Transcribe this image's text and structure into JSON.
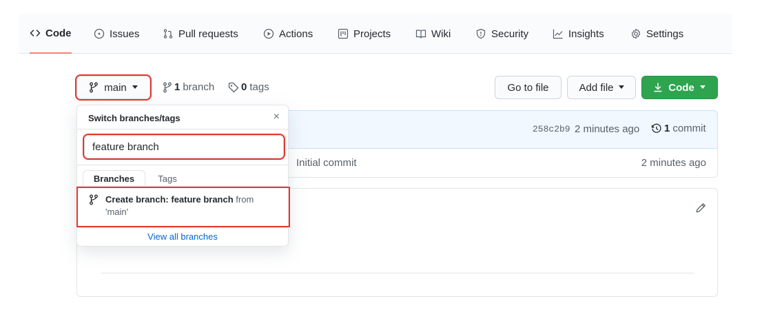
{
  "nav": {
    "tabs": [
      {
        "label": "Code",
        "icon": "code-icon",
        "active": true
      },
      {
        "label": "Issues",
        "icon": "issue-opened-icon"
      },
      {
        "label": "Pull requests",
        "icon": "git-pull-request-icon"
      },
      {
        "label": "Actions",
        "icon": "play-icon"
      },
      {
        "label": "Projects",
        "icon": "project-icon"
      },
      {
        "label": "Wiki",
        "icon": "book-icon"
      },
      {
        "label": "Security",
        "icon": "shield-icon"
      },
      {
        "label": "Insights",
        "icon": "graph-icon"
      },
      {
        "label": "Settings",
        "icon": "gear-icon"
      }
    ]
  },
  "toolbar": {
    "branch_button_label": "main",
    "branch_count": "1",
    "branch_word": "branch",
    "tag_count": "0",
    "tag_word": "tags",
    "go_to_file": "Go to file",
    "add_file": "Add file",
    "code": "Code"
  },
  "repo": {
    "commit_sha": "258c2b9",
    "commit_time": "2 minutes ago",
    "commit_count": "1",
    "commit_word": "commit",
    "row_message": "Initial commit",
    "row_time": "2 minutes ago"
  },
  "dropdown": {
    "title": "Switch branches/tags",
    "close_symbol": "×",
    "filter_value": "feature branch",
    "tabs": [
      "Branches",
      "Tags"
    ],
    "create_prefix": "Create branch: feature branch",
    "create_from_word": "from",
    "create_source": "'main'",
    "footer_link": "View all branches"
  },
  "colors": {
    "accent_red": "#e5372c",
    "green_button": "#2ea44f",
    "link_blue": "#0366d6",
    "active_tab_underline": "#f9826c"
  }
}
